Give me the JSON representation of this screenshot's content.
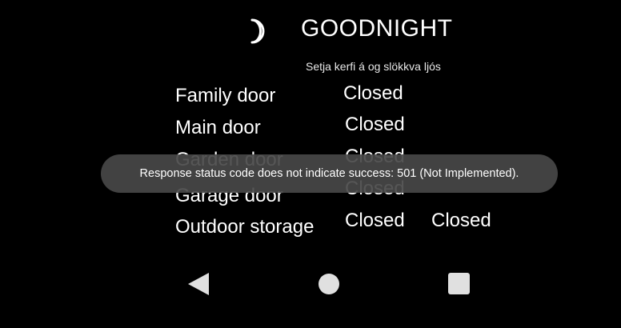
{
  "header": {
    "icon": "crescent-moon-icon",
    "title": "GOODNIGHT",
    "subtitle": "Setja kerfi á og slökkva ljós"
  },
  "doors": [
    {
      "name": "Family door",
      "status": "Closed",
      "status2": ""
    },
    {
      "name": "Main door",
      "status": "Closed",
      "status2": ""
    },
    {
      "name": "Garden door",
      "status": "Closed",
      "status2": ""
    },
    {
      "name": "Garage door",
      "status": "Closed",
      "status2": ""
    },
    {
      "name": "Outdoor storage",
      "status": "Closed",
      "status2": "Closed"
    }
  ],
  "toast": {
    "message": "Response status code does not indicate success: 501 (Not Implemented)."
  },
  "navbar": {
    "back_icon": "back-triangle-icon",
    "home_icon": "home-circle-icon",
    "recent_icon": "recent-apps-square-icon"
  },
  "colors": {
    "background": "#000000",
    "text": "#ffffff",
    "toast_bg": "#484848",
    "nav_icons": "#e0e0e0"
  }
}
